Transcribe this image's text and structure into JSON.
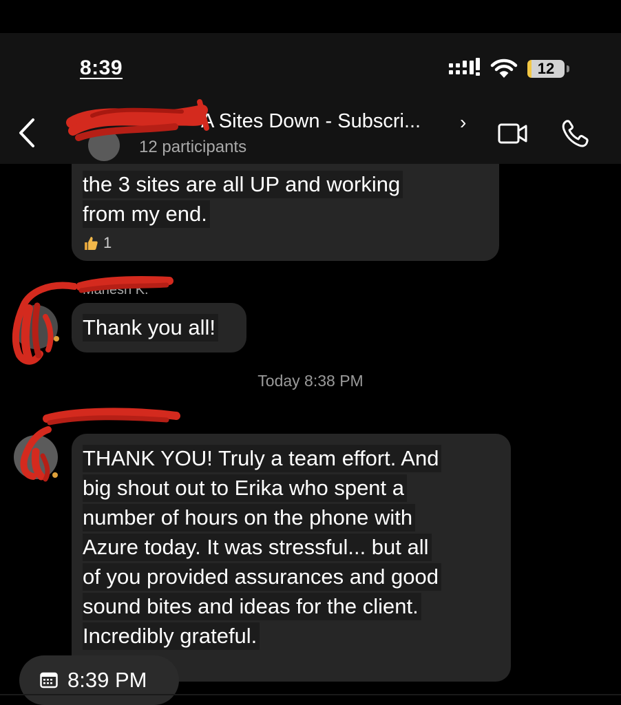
{
  "status_bar": {
    "time": "8:39",
    "battery_level": "12",
    "signal_icon": "cellular-signal-icon",
    "wifi_icon": "wifi-icon"
  },
  "header": {
    "title": "A Sites Down - Subscri...",
    "chevron": "›",
    "participants": "12 participants",
    "icons": [
      "back-chevron-icon",
      "video-call-icon",
      "phone-call-icon"
    ]
  },
  "messages": [
    {
      "lines": [
        "the 3 sites are all UP and working",
        "from my end."
      ],
      "reaction": {
        "icon": "thumbs-up-icon",
        "count": "1"
      }
    },
    {
      "sender": "Mahesh K.",
      "lines": [
        "Thank you all!"
      ]
    },
    {
      "lines": [
        "THANK YOU! Truly a team effort. And",
        "big shout out to Erika  who spent a",
        "number of hours on the phone with",
        "Azure today. It was stressful... but all",
        "of you provided assurances and good",
        "sound bites and ideas for the client.",
        "Incredibly grateful."
      ]
    }
  ],
  "timestamp_divider": "Today 8:38 PM",
  "time_pill": {
    "label": "8:39 PM",
    "icon": "calendar-icon"
  },
  "colors": {
    "background": "#000000",
    "header": "#131313",
    "bubble": "#262626",
    "redaction": "#d42a1e",
    "battery_fill": "#f2c744"
  }
}
